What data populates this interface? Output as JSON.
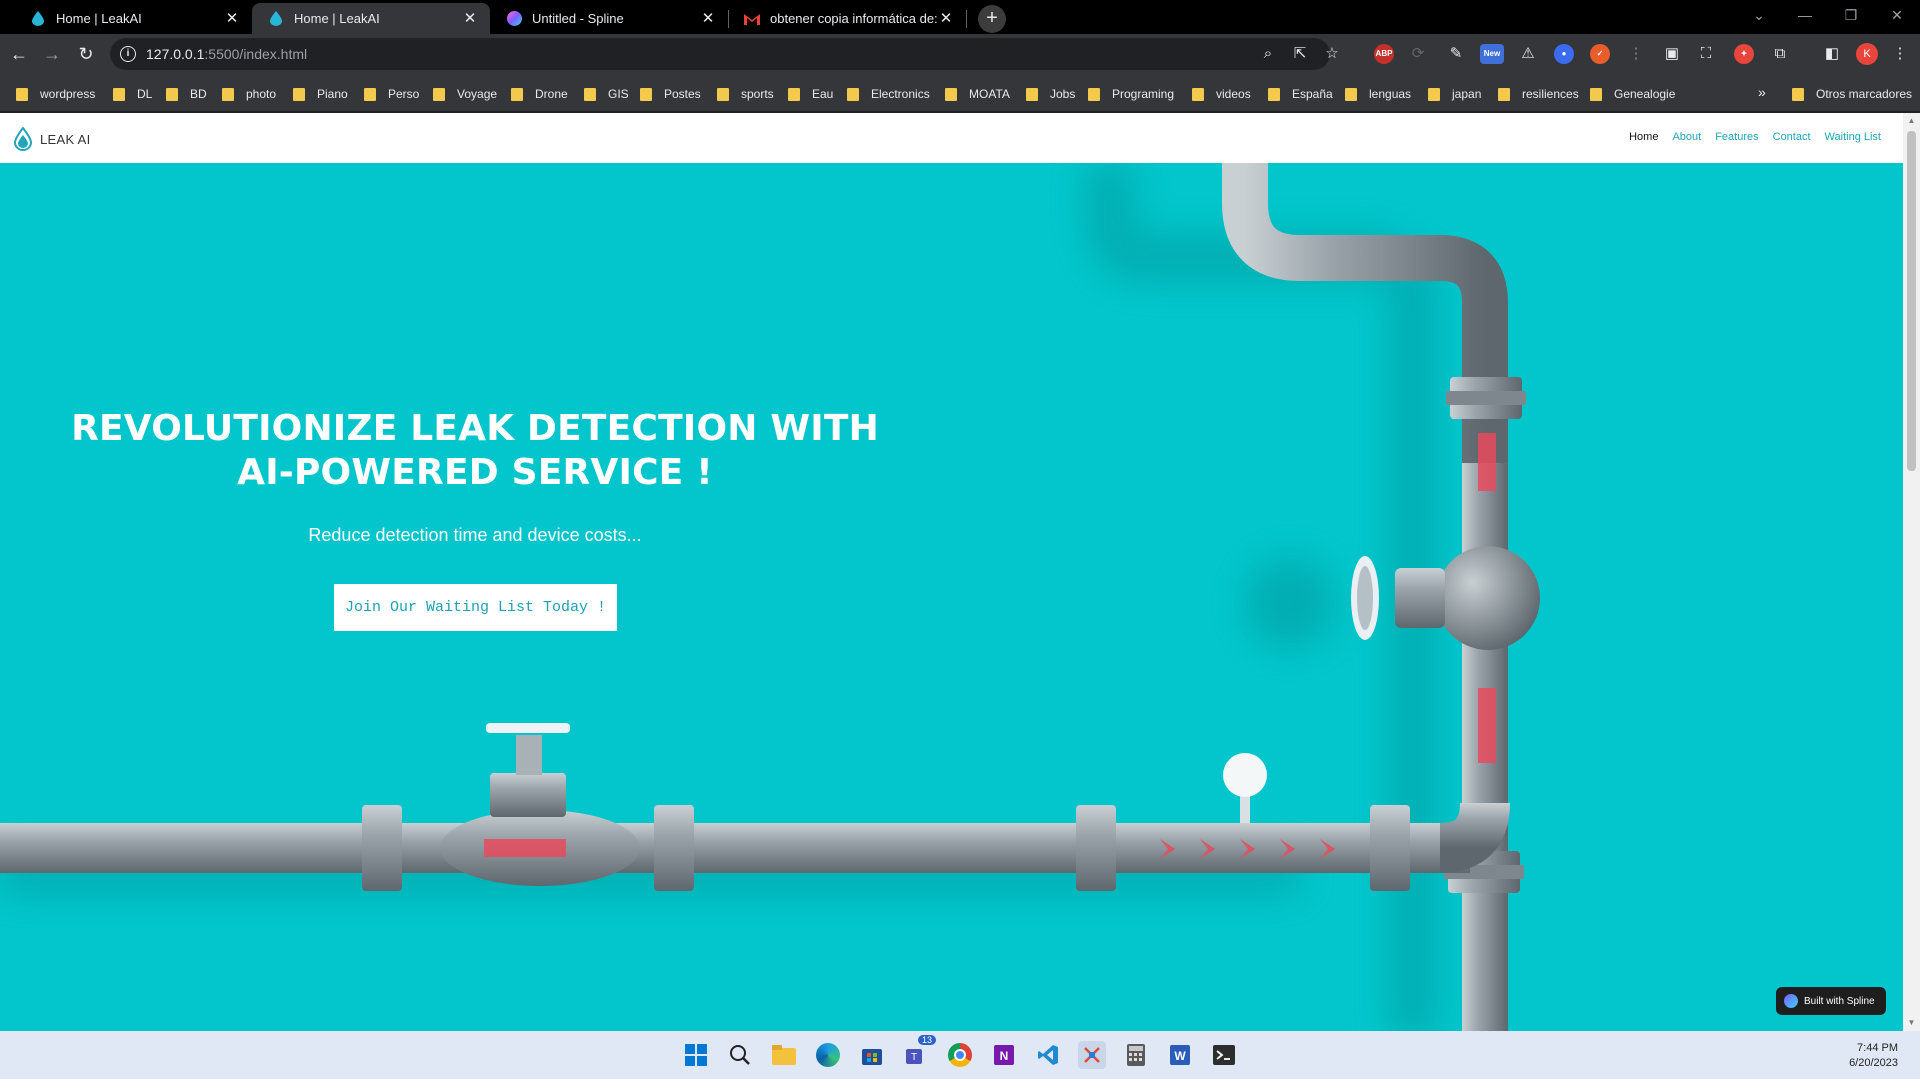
{
  "browser": {
    "tabs": [
      {
        "title": "Home | LeakAI",
        "favicon": "drop-icon",
        "active": false
      },
      {
        "title": "Home | LeakAI",
        "favicon": "drop-icon",
        "active": true
      },
      {
        "title": "Untitled - Spline",
        "favicon": "spline-icon",
        "active": false
      },
      {
        "title": "obtener copia informática de: l",
        "favicon": "gmail-icon",
        "active": false
      }
    ],
    "url_host": "127.0.0.1",
    "url_rest": ":5500/index.html",
    "profile_initial": "K",
    "ext_abp": "ABP",
    "ext_new_badge": "New",
    "bookmarks": [
      "wordpress",
      "DL",
      "BD",
      "photo",
      "Piano",
      "Perso",
      "Voyage",
      "Drone",
      "GIS",
      "Postes",
      "sports",
      "Eau",
      "Electronics",
      "MOATA",
      "Jobs",
      "Programing",
      "videos",
      "España",
      "lenguas",
      "japan",
      "resiliences",
      "Genealogie"
    ],
    "bookmarks_more": "»",
    "other_bookmarks": "Otros marcadores"
  },
  "site": {
    "brand": "LEAK AI",
    "nav": [
      "Home",
      "About",
      "Features",
      "Contact",
      "Waiting List"
    ],
    "active_nav": "Home",
    "hero_title": "REVOLUTIONIZE LEAK DETECTION WITH AI-POWERED SERVICE !",
    "hero_subtitle": "Reduce detection time and device costs...",
    "cta_label": "Join Our Waiting List Today !",
    "spline_badge": "Built with Spline",
    "colors": {
      "hero_bg": "#02c6cb",
      "accent": "#1fa6b8",
      "pipe": "#8f9aa1",
      "leak_marks": "#e84b5e"
    }
  },
  "taskbar": {
    "time": "7:44 PM",
    "date": "6/20/2023",
    "teams_badge": "13",
    "icons": [
      "windows-start-icon",
      "search-icon",
      "file-explorer-icon",
      "edge-icon",
      "store-icon",
      "teams-icon",
      "chrome-icon",
      "onenote-icon",
      "vscode-icon",
      "snipping-tool-icon",
      "calculator-icon",
      "word-icon",
      "terminal-icon"
    ]
  }
}
